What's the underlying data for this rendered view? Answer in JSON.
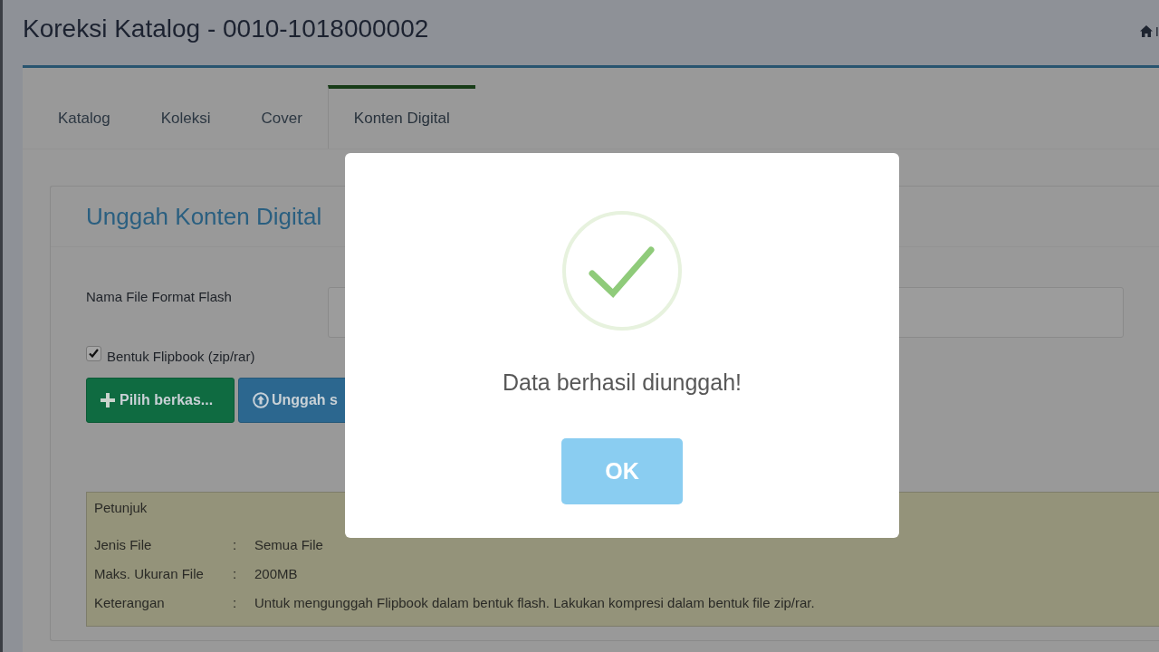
{
  "page": {
    "title": "Koreksi Katalog - 0010-1018000002",
    "breadcrumb": "I"
  },
  "tabs": [
    {
      "label": "Katalog",
      "selected": false
    },
    {
      "label": "Koleksi",
      "selected": false
    },
    {
      "label": "Cover",
      "selected": false
    },
    {
      "label": "Konten Digital",
      "selected": true
    }
  ],
  "upload_panel": {
    "title": "Unggah Konten Digital",
    "fields": [
      {
        "label": "Nama File Format Flash"
      }
    ],
    "flipbook": {
      "label": "Bentuk Flipbook (zip/rar)",
      "checked": true
    },
    "buttons": [
      {
        "label": "Pilih berkas...",
        "kind": "add"
      },
      {
        "label": "Unggah s",
        "kind": "upload"
      }
    ]
  },
  "hint": {
    "title": "Petunjuk",
    "rows": [
      {
        "label": "Jenis File",
        "separator": ":",
        "value": "Semua File"
      },
      {
        "label": "Maks. Ukuran File",
        "separator": ":",
        "value": "200MB"
      },
      {
        "label": "Keterangan",
        "separator": ":",
        "value": "Untuk mengunggah Flipbook dalam bentuk flash. Lakukan kompresi dalam bentuk file zip/rar."
      }
    ]
  },
  "dialog": {
    "message": "Data berhasil diunggah!",
    "confirm": "OK"
  }
}
